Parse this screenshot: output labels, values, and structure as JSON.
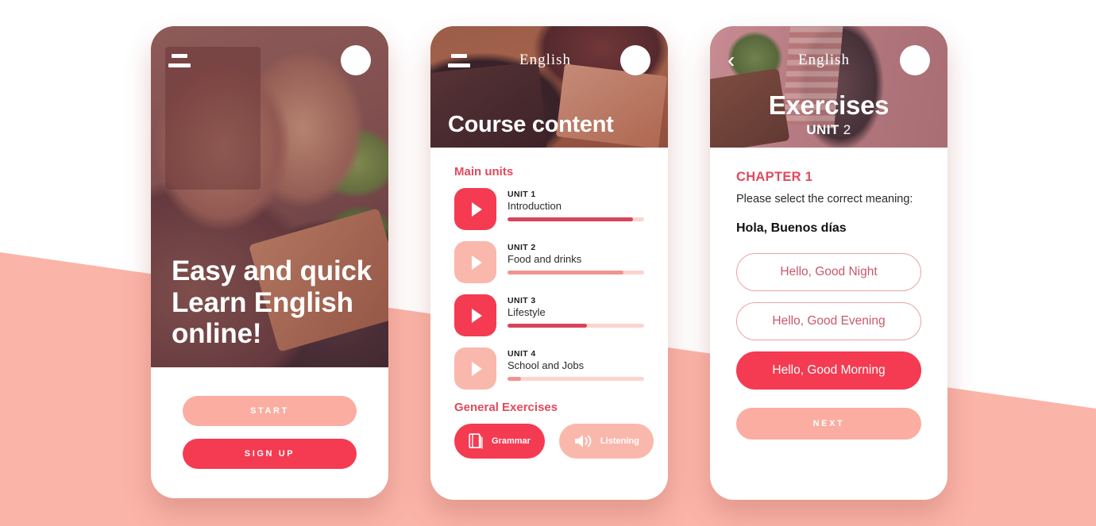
{
  "theme": {
    "accent": "#F43B52",
    "accent_soft": "#FAB8AC",
    "bg_pink": "#FBB4A8",
    "heading_red": "#E24A5C"
  },
  "background": {
    "shape": "diagonal-pink-band"
  },
  "screen1": {
    "name": "onboarding",
    "menu_icon": "hamburger-icon",
    "avatar": "avatar",
    "headline": "Easy and quick Learn English online!",
    "buttons": {
      "start": "START",
      "sign_up": "SIGN UP"
    }
  },
  "screen2": {
    "name": "course-content",
    "menu_icon": "hamburger-icon",
    "brand": "English",
    "avatar": "avatar",
    "hero_title": "Course content",
    "main_units_title": "Main units",
    "units": [
      {
        "label": "UNIT 1",
        "name": "Introduction",
        "progress": 92,
        "active": true,
        "icon": "play-icon"
      },
      {
        "label": "UNIT 2",
        "name": "Food and drinks",
        "progress": 85,
        "active": false,
        "icon": "play-icon"
      },
      {
        "label": "UNIT 3",
        "name": "Lifestyle",
        "progress": 58,
        "active": true,
        "icon": "play-icon"
      },
      {
        "label": "UNIT 4",
        "name": "School and Jobs",
        "progress": 10,
        "active": false,
        "icon": "play-icon"
      }
    ],
    "general_exercises_title": "General Exercises",
    "exercises": [
      {
        "label": "Grammar",
        "icon": "book-icon",
        "active": true
      },
      {
        "label": "Listening",
        "icon": "speaker-icon",
        "active": false
      },
      {
        "label": "",
        "icon": "notebook-icon",
        "active": true
      }
    ]
  },
  "screen3": {
    "name": "exercises",
    "back_icon": "chevron-left-icon",
    "brand": "English",
    "avatar": "avatar",
    "hero_title": "Exercises",
    "hero_subtitle_label": "UNIT",
    "hero_subtitle_value": "2",
    "chapter": "CHAPTER 1",
    "prompt": "Please select the correct meaning:",
    "phrase": "Hola, Buenos días",
    "options": [
      {
        "text": "Hello, Good Night",
        "selected": false
      },
      {
        "text": "Hello, Good Evening",
        "selected": false
      },
      {
        "text": "Hello, Good Morning",
        "selected": true
      }
    ],
    "next_label": "NEXT"
  }
}
